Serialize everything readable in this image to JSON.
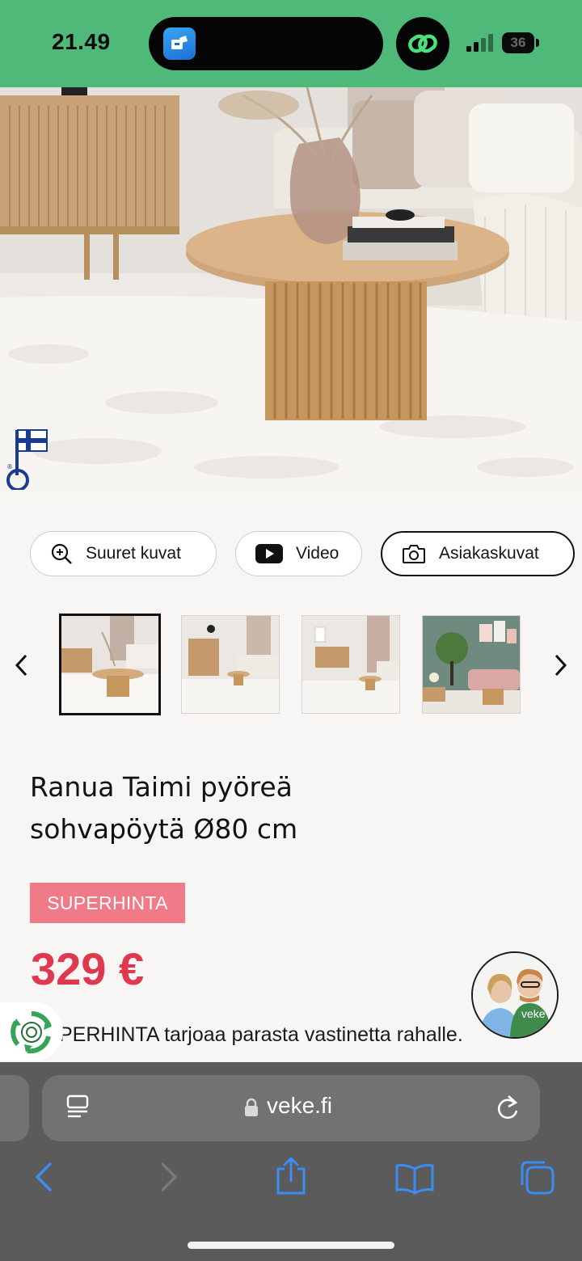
{
  "status_bar": {
    "time": "21.49",
    "battery": "36"
  },
  "media_buttons": {
    "large_images": "Suuret kuvat",
    "video": "Video",
    "customer_photos": "Asiakaskuvat"
  },
  "product": {
    "title_line1": "Ranua Taimi pyöreä",
    "title_line2": "sohvapöytä Ø80 cm",
    "badge": "SUPERHINTA",
    "price": "329 €",
    "description": "PERHINTA tarjoaa parasta vastinetta rahalle."
  },
  "chat": {
    "avatar_logo": "veke"
  },
  "browser": {
    "url": "veke.fi"
  },
  "colors": {
    "status_bar": "#4fb97a",
    "badge": "#f07a87",
    "price": "#e0394f",
    "toolbar_icons": "#3b8cf5"
  }
}
